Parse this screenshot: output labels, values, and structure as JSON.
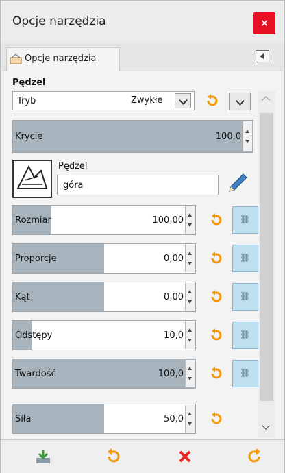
{
  "window": {
    "title": "Opcje narzędzia",
    "close_label": "×"
  },
  "tab": {
    "label": "Opcje narzędzia"
  },
  "group_label": "Pędzel",
  "mode": {
    "label": "Tryb",
    "value": "Zwykłe"
  },
  "opacity": {
    "label": "Krycie",
    "value": "100,0",
    "fraction": 1.0
  },
  "brush": {
    "label": "Pędzel",
    "name": "góra"
  },
  "sliders": [
    {
      "key": "size",
      "label": "Rozmiar",
      "value": "100,00",
      "fraction": 0.21,
      "chain": true
    },
    {
      "key": "aspect",
      "label": "Proporcje",
      "value": "0,00",
      "fraction": 0.5,
      "chain": true
    },
    {
      "key": "angle",
      "label": "Kąt",
      "value": "0,00",
      "fraction": 0.5,
      "chain": true
    },
    {
      "key": "spacing",
      "label": "Odstępy",
      "value": "10,0",
      "fraction": 0.1,
      "chain": true
    },
    {
      "key": "hardness",
      "label": "Twardość",
      "value": "100,0",
      "fraction": 1.0,
      "chain": true
    },
    {
      "key": "force",
      "label": "Siła",
      "value": "50,0",
      "fraction": 0.5,
      "chain": false
    }
  ],
  "chain_symbol": "⛓",
  "colors": {
    "accent_fill": "#a7b4bd",
    "close": "#e81123",
    "reset": "#f29a0c",
    "delete": "#e22"
  },
  "icons": {
    "save": "save-icon",
    "restore": "restore-icon",
    "delete": "delete-icon",
    "reset": "reset-icon"
  }
}
